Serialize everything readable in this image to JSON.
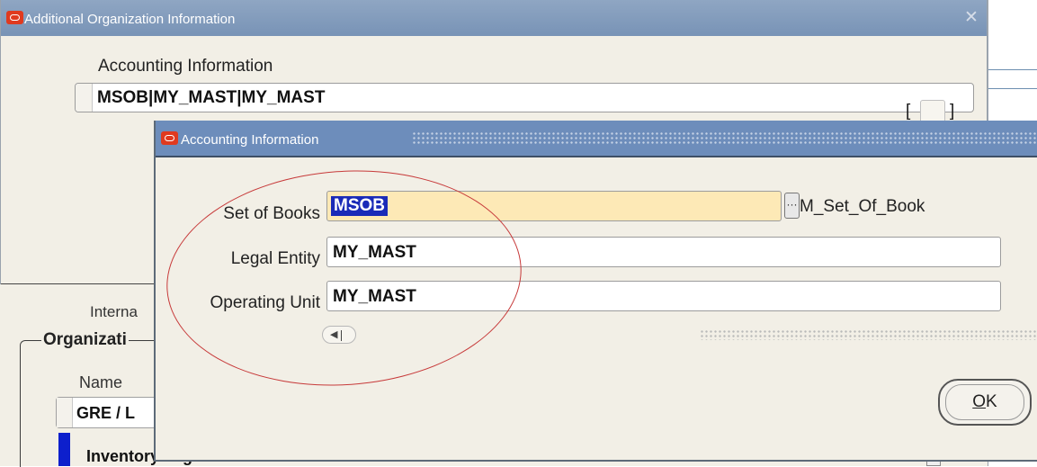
{
  "main_window": {
    "title": "Additional Organization Information",
    "close_icon": "close-icon",
    "accounting_label": "Accounting Information",
    "accounting_value": "MSOB|MY_MAST|MY_MAST",
    "bracket_left": "[",
    "bracket_right": "]",
    "internal_label_partial": "Interna",
    "org_group_title_partial": "Organizati",
    "name_label": "Name",
    "rows": [
      {
        "value_partial": "GRE / L"
      },
      {
        "value_partial": "Inventory Organization"
      }
    ]
  },
  "dialog": {
    "title": "Accounting Information",
    "fields": {
      "set_of_books": {
        "label": "Set of Books",
        "value": "MSOB",
        "description": "M_Set_Of_Book",
        "lov_icon": "ellipsis-icon"
      },
      "legal_entity": {
        "label": "Legal Entity",
        "value": "MY_MAST"
      },
      "operating_unit": {
        "label": "Operating Unit",
        "value": "MY_MAST"
      }
    },
    "ok_button": {
      "label_mnemonic": "O",
      "label_rest": "K"
    }
  },
  "colors": {
    "titlebar_active": "#6d8dbb",
    "titlebar_inactive": "#8fa6c3",
    "form_background": "#f2efe6",
    "required_field": "#fde9b6",
    "selection": "#1a2bb8",
    "annotation": "#c73a3a"
  }
}
